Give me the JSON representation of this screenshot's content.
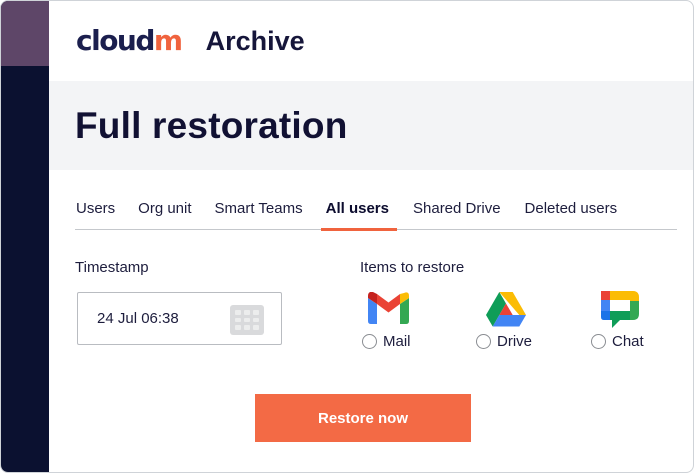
{
  "header": {
    "brand_main": "cloud",
    "brand_accent": "m",
    "app_title": "Archive"
  },
  "page": {
    "title": "Full restoration"
  },
  "tabs": [
    {
      "label": "Users",
      "active": false
    },
    {
      "label": "Org unit",
      "active": false
    },
    {
      "label": "Smart Teams",
      "active": false
    },
    {
      "label": "All users",
      "active": true
    },
    {
      "label": "Shared Drive",
      "active": false
    },
    {
      "label": "Deleted users",
      "active": false
    }
  ],
  "timestamp": {
    "label": "Timestamp",
    "value": "24 Jul 06:38",
    "icon": "calendar-icon"
  },
  "items": {
    "label": "Items to restore",
    "options": [
      {
        "label": "Mail",
        "icon": "gmail-icon",
        "selected": false
      },
      {
        "label": "Drive",
        "icon": "google-drive-icon",
        "selected": false
      },
      {
        "label": "Chat",
        "icon": "google-chat-icon",
        "selected": false
      }
    ]
  },
  "actions": {
    "restore_label": "Restore now"
  },
  "colors": {
    "accent": "#f36a45",
    "rail": "#0b1130",
    "rail_top": "#5e4668",
    "brand": "#1b1f4e",
    "banner_bg": "#f3f4f6"
  }
}
